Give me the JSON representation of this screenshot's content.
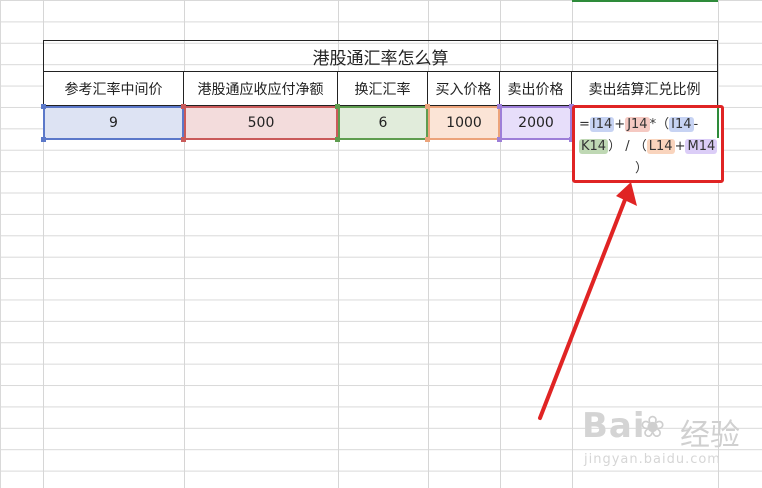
{
  "sheet": {
    "title": "港股通汇率怎么算",
    "headers": [
      "参考汇率中间价",
      "港股通应收应付净额",
      "换汇汇率",
      "买入价格",
      "卖出价格",
      "卖出结算汇兑比例"
    ],
    "values": [
      "9",
      "500",
      "6",
      "1000",
      "2000"
    ],
    "formula": {
      "eq": "=",
      "i14": "I14",
      "plus1": "+",
      "j14": "J14",
      "times": "*",
      "lparen1": "（",
      "i14b": "I14",
      "minus": "-",
      "k14": "K14",
      "rparen1": "）",
      "div": "/",
      "lparen2": "（",
      "l14": "L14",
      "plus2": "+",
      "m14": "M14",
      "rparen2": "）"
    }
  },
  "colors": {
    "highlight_red": "#e02424",
    "ref_blue": "#5b78c9",
    "ref_red": "#c95a5a",
    "ref_green": "#5e9c4e",
    "ref_orange": "#eca37a",
    "ref_purple": "#9d7ed8"
  },
  "watermark": {
    "logo": "Bai",
    "brand": "经验",
    "url": "jingyan.baidu.com"
  }
}
